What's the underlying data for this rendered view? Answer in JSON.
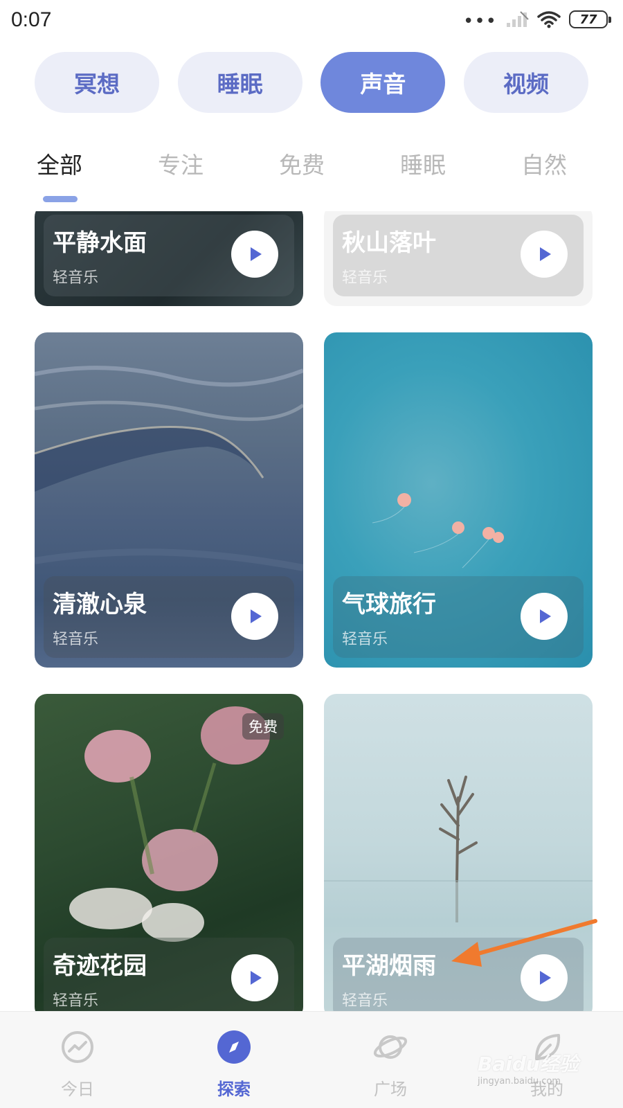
{
  "status_bar": {
    "time": "0:07",
    "dots": "•••",
    "battery": "77"
  },
  "category_pills": [
    {
      "label": "冥想",
      "active": false
    },
    {
      "label": "睡眠",
      "active": false
    },
    {
      "label": "声音",
      "active": true
    },
    {
      "label": "视频",
      "active": false
    }
  ],
  "sub_tabs": [
    {
      "label": "全部",
      "active": true
    },
    {
      "label": "专注",
      "active": false
    },
    {
      "label": "免费",
      "active": false
    },
    {
      "label": "睡眠",
      "active": false
    },
    {
      "label": "自然",
      "active": false
    }
  ],
  "cards": [
    {
      "title": "平静水面",
      "subtitle": "轻音乐",
      "badge": ""
    },
    {
      "title": "秋山落叶",
      "subtitle": "轻音乐",
      "badge": ""
    },
    {
      "title": "清澈心泉",
      "subtitle": "轻音乐",
      "badge": ""
    },
    {
      "title": "气球旅行",
      "subtitle": "轻音乐",
      "badge": ""
    },
    {
      "title": "奇迹花园",
      "subtitle": "轻音乐",
      "badge": "免费"
    },
    {
      "title": "平湖烟雨",
      "subtitle": "轻音乐",
      "badge": ""
    }
  ],
  "bottom_nav": [
    {
      "label": "今日",
      "icon": "trend-icon",
      "active": false
    },
    {
      "label": "探索",
      "icon": "compass-icon",
      "active": true
    },
    {
      "label": "广场",
      "icon": "planet-icon",
      "active": false
    },
    {
      "label": "我的",
      "icon": "leaf-icon",
      "active": false
    }
  ],
  "colors": {
    "accent": "#6f87dc",
    "pill_bg": "#eceef8",
    "nav_active": "#5467d3",
    "play_icon": "#5467d3",
    "arrow": "#f07a2e"
  },
  "watermark": {
    "main": "Baidu经验",
    "sub": "jingyan.baidu.com"
  }
}
